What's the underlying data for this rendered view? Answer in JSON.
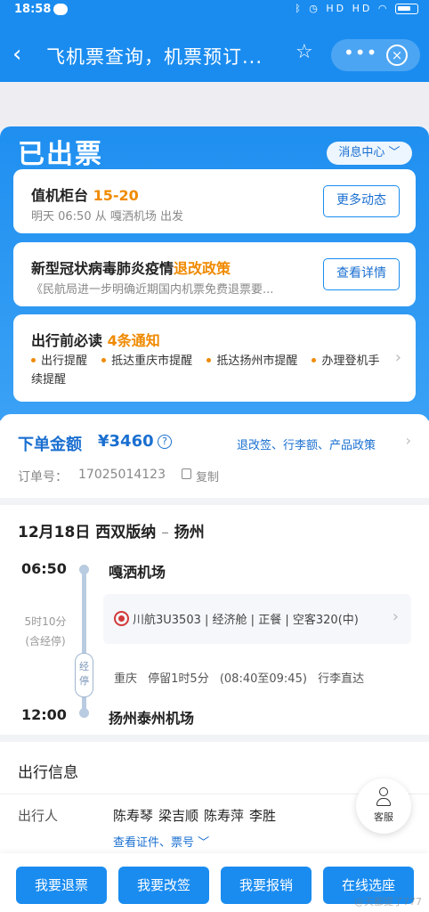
{
  "status_bar": {
    "time": "18:58",
    "icons": "HD HD"
  },
  "navbar": {
    "back": "‹",
    "title": "飞机票查询，机票预订...",
    "star": "☆",
    "more": "•••",
    "close": "×"
  },
  "ticket_status": "已出票",
  "message_center": "消息中心 ﹀",
  "checkin_card": {
    "title": "值机柜台",
    "counter": "15-20",
    "detail": "明天 06:50 从 嘎洒机场 出发",
    "button": "更多动态"
  },
  "covid_card": {
    "title": "新型冠状病毒肺炎疫情",
    "highlight": "退改政策",
    "detail": "《民航局进一步明确近期国内机票免费退票要...",
    "button": "查看详情"
  },
  "notice_card": {
    "title": "出行前必读",
    "count": "4条通知",
    "items": [
      "出行提醒",
      "抵达重庆市提醒",
      "抵达扬州市提醒",
      "办理登机手续提醒"
    ]
  },
  "order": {
    "label": "下单金额",
    "amount": "¥3460",
    "help": "?",
    "policy": "退改签、行李额、产品政策",
    "order_no_label": "订单号：",
    "order_no": "17025014123",
    "copy": "复制"
  },
  "flight": {
    "date": "12月18日",
    "from_city": "西双版纳",
    "dash": "–",
    "to_city": "扬州",
    "dep_time": "06:50",
    "dep_airport": "嘎洒机场",
    "duration": "5时10分",
    "duration_note": "(含经停)",
    "stop_badge": "经停",
    "airline": "川航3U3503",
    "cabin": "经济舱",
    "meal": "正餐",
    "aircraft": "空客320(中)",
    "stop_city": "重庆",
    "stop_duration": "停留1时5分",
    "stop_window": "(08:40至09:45)",
    "baggage": "行李直达",
    "arr_time": "12:00",
    "arr_airport": "扬州泰州机场"
  },
  "travel": {
    "heading": "出行信息",
    "passenger_label": "出行人",
    "passengers": [
      "陈寿琴",
      "梁吉顺",
      "陈寿萍",
      "李胜"
    ],
    "docs_link": "查看证件、票号 ﹀"
  },
  "service": "客服",
  "bottom_buttons": [
    "我要退票",
    "我要改签",
    "我要报销",
    "在线选座"
  ],
  "watermark": "@天都提了777"
}
